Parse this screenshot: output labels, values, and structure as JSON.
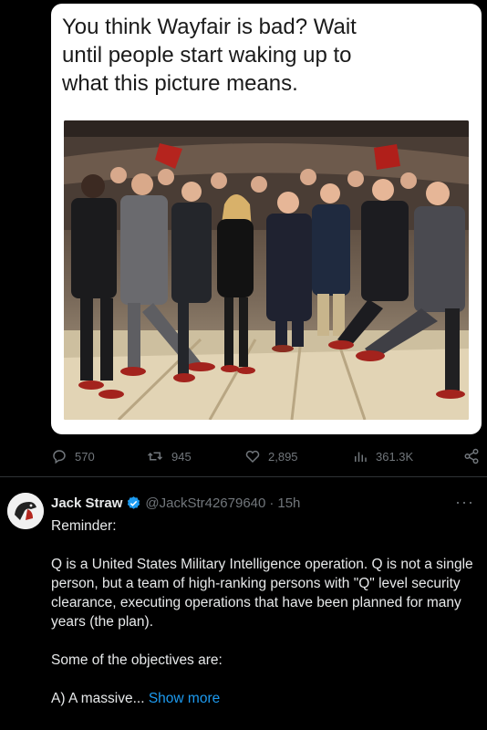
{
  "quote": {
    "text_line1": "You think Wayfair is bad? Wait",
    "text_line2": "until people start waking up to",
    "text_line3": "what this picture means."
  },
  "engagement": {
    "replies": "570",
    "retweets": "945",
    "likes": "2,895",
    "views": "361.3K"
  },
  "tweet": {
    "author_name": "Jack Straw",
    "handle": "@JackStr42679640",
    "separator": "·",
    "time": "15h",
    "line_reminder": "Reminder:",
    "para1": "Q is a United States Military Intelligence operation. Q is not a single person, but a team of high-ranking persons with \"Q\" level security clearance, executing operations that have been planned for many years (the plan).",
    "para2": "Some of the objectives are:",
    "para3_prefix": "A) A massive...",
    "show_more": "Show more",
    "more_label": "···"
  },
  "colors": {
    "background": "#000000",
    "text": "#e7e9ea",
    "muted": "#71767b",
    "link": "#1d9bf0",
    "verified": "#1d9bf0"
  },
  "icons": {
    "reply": "reply-icon",
    "retweet": "retweet-icon",
    "like": "heart-icon",
    "views": "views-icon",
    "share": "share-icon",
    "verified": "verified-badge-icon",
    "more": "more-options-icon"
  }
}
